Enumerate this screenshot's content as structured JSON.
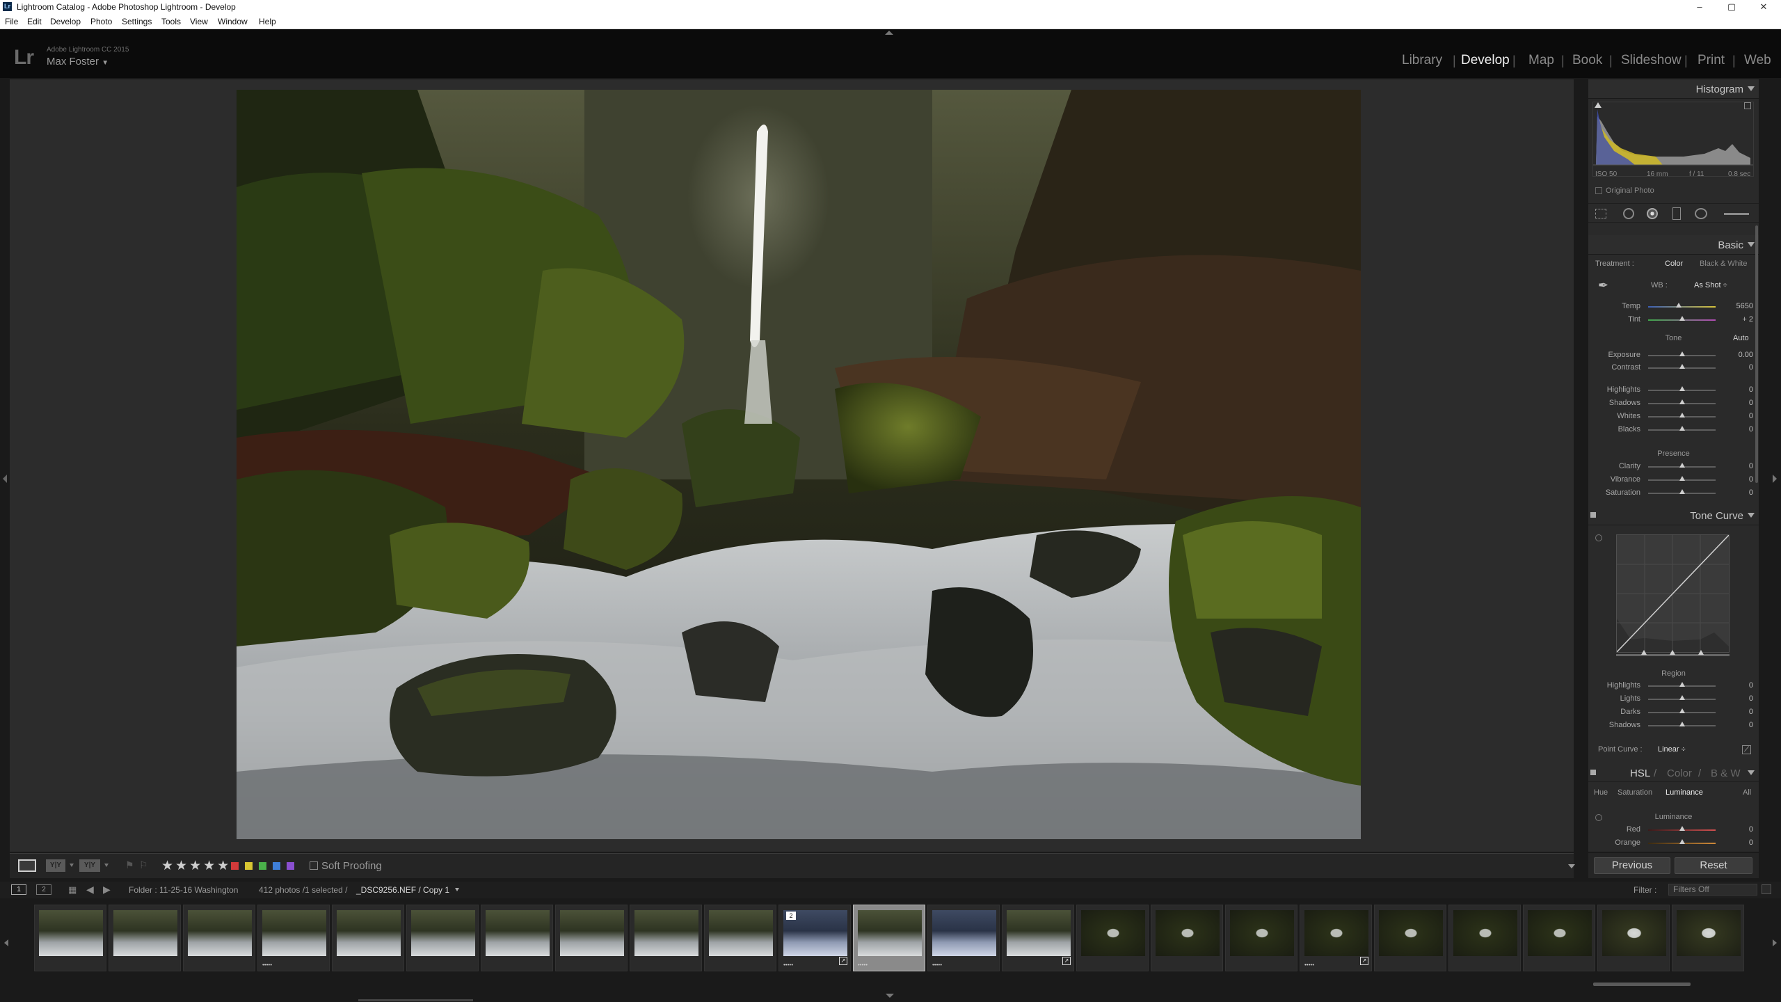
{
  "window": {
    "title": "Lightroom Catalog - Adobe Photoshop Lightroom - Develop",
    "icon": "Lr"
  },
  "menu": [
    "File",
    "Edit",
    "Develop",
    "Photo",
    "Settings",
    "Tools",
    "View",
    "Window",
    "Help"
  ],
  "identity": {
    "logo": "Lr",
    "product": "Adobe Lightroom CC 2015",
    "user": "Max Foster"
  },
  "modules": [
    "Library",
    "Develop",
    "Map",
    "Book",
    "Slideshow",
    "Print",
    "Web"
  ],
  "active_module": "Develop",
  "toolbar": {
    "stars": "★★★★★",
    "soft_proofing": "Soft Proofing",
    "color_labels": [
      "#d23a3a",
      "#d8c632",
      "#4ab04a",
      "#3f7fd8",
      "#8a4fd0"
    ]
  },
  "histogram": {
    "title": "Histogram",
    "iso": "ISO 50",
    "focal": "16 mm",
    "aperture": "f / 11",
    "shutter": "0.8 sec",
    "original_photo": "Original Photo"
  },
  "basic": {
    "title": "Basic",
    "treatment_label": "Treatment :",
    "color": "Color",
    "bw": "Black & White",
    "wb_label": "WB :",
    "wb_value": "As Shot ÷",
    "tone_label": "Tone",
    "auto": "Auto",
    "presence_label": "Presence",
    "sliders": [
      {
        "label": "Temp",
        "value": "5650",
        "pos": 0.45
      },
      {
        "label": "Tint",
        "value": "+ 2",
        "pos": 0.51
      },
      {
        "label": "Exposure",
        "value": "0.00",
        "pos": 0.5
      },
      {
        "label": "Contrast",
        "value": "0",
        "pos": 0.5
      },
      {
        "label": "Highlights",
        "value": "0",
        "pos": 0.5
      },
      {
        "label": "Shadows",
        "value": "0",
        "pos": 0.5
      },
      {
        "label": "Whites",
        "value": "0",
        "pos": 0.5
      },
      {
        "label": "Blacks",
        "value": "0",
        "pos": 0.5
      },
      {
        "label": "Clarity",
        "value": "0",
        "pos": 0.5
      },
      {
        "label": "Vibrance",
        "value": "0",
        "pos": 0.5
      },
      {
        "label": "Saturation",
        "value": "0",
        "pos": 0.5
      }
    ]
  },
  "tone_curve": {
    "title": "Tone Curve",
    "region_label": "Region",
    "point_curve_label": "Point Curve :",
    "point_curve_value": "Linear ÷",
    "sliders": [
      {
        "label": "Highlights",
        "value": "0",
        "pos": 0.5
      },
      {
        "label": "Lights",
        "value": "0",
        "pos": 0.5
      },
      {
        "label": "Darks",
        "value": "0",
        "pos": 0.5
      },
      {
        "label": "Shadows",
        "value": "0",
        "pos": 0.5
      }
    ]
  },
  "hsl": {
    "title_hsl": "HSL",
    "slash1": "/",
    "title_color": "Color",
    "slash2": "/",
    "title_bw": "B & W",
    "tabs": [
      "Hue",
      "Saturation",
      "Luminance",
      "All"
    ],
    "active_tab": "Luminance",
    "section": "Luminance",
    "sliders": [
      {
        "label": "Red",
        "value": "0",
        "pos": 0.5
      },
      {
        "label": "Orange",
        "value": "0",
        "pos": 0.5
      }
    ]
  },
  "buttons": {
    "previous": "Previous",
    "reset": "Reset"
  },
  "filmstrip": {
    "screen1": "1",
    "screen2": "2",
    "folder": "Folder : 11-25-16 Washington",
    "count": "412 photos /1 selected /",
    "file": "_DSC9256.NEF / Copy 1",
    "filter_label": "Filter :",
    "filter_value": "Filters Off",
    "thumbs": [
      {
        "stars": "",
        "badge": "",
        "corner": "",
        "kind": "falls"
      },
      {
        "stars": "",
        "badge": "",
        "corner": "",
        "kind": "falls"
      },
      {
        "stars": "",
        "badge": "",
        "corner": "",
        "kind": "falls"
      },
      {
        "stars": "•••••",
        "badge": "",
        "corner": "",
        "kind": "falls"
      },
      {
        "stars": "",
        "badge": "",
        "corner": "",
        "kind": "falls"
      },
      {
        "stars": "",
        "badge": "",
        "corner": "",
        "kind": "falls"
      },
      {
        "stars": "",
        "badge": "",
        "corner": "",
        "kind": "falls"
      },
      {
        "stars": "",
        "badge": "",
        "corner": "",
        "kind": "falls"
      },
      {
        "stars": "",
        "badge": "",
        "corner": "",
        "kind": "falls"
      },
      {
        "stars": "",
        "badge": "",
        "corner": "",
        "kind": "falls"
      },
      {
        "stars": "•••••",
        "badge": "2",
        "corner": "↗",
        "kind": "blue"
      },
      {
        "stars": "•••••",
        "badge": "",
        "corner": "",
        "kind": "falls",
        "selected": true
      },
      {
        "stars": "•••••",
        "badge": "",
        "corner": "",
        "kind": "blue"
      },
      {
        "stars": "",
        "badge": "",
        "corner": "↗",
        "kind": "falls"
      },
      {
        "stars": "",
        "badge": "",
        "corner": "",
        "kind": "forest"
      },
      {
        "stars": "",
        "badge": "",
        "corner": "",
        "kind": "forest"
      },
      {
        "stars": "",
        "badge": "",
        "corner": "",
        "kind": "forest"
      },
      {
        "stars": "•••••",
        "badge": "",
        "corner": "↗",
        "kind": "forest"
      },
      {
        "stars": "",
        "badge": "",
        "corner": "",
        "kind": "forest"
      },
      {
        "stars": "",
        "badge": "",
        "corner": "",
        "kind": "forest"
      },
      {
        "stars": "",
        "badge": "",
        "corner": "",
        "kind": "forest"
      },
      {
        "stars": "",
        "badge": "",
        "corner": "",
        "kind": "forest2"
      },
      {
        "stars": "",
        "badge": "",
        "corner": "",
        "kind": "forest2"
      }
    ]
  }
}
